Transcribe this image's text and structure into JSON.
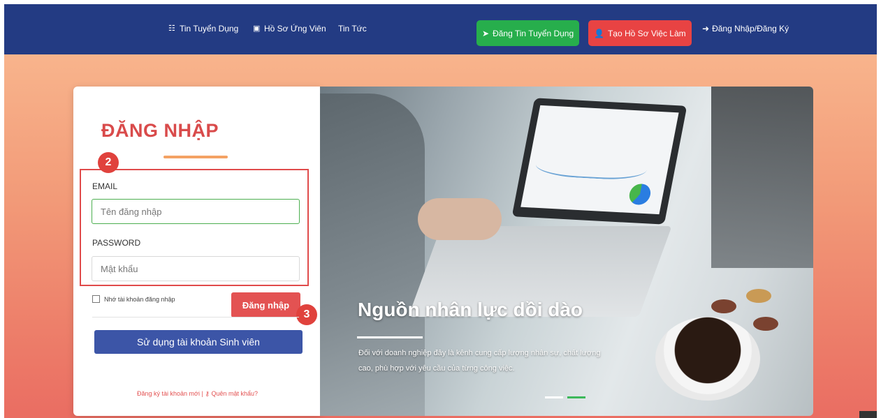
{
  "nav": {
    "jobs": "Tin Tuyển Dụng",
    "candidates": "Hồ Sơ Ứng Viên",
    "news": "Tin Tức",
    "post_job": "Đăng Tin Tuyển Dụng",
    "create_profile": "Tạo Hồ Sơ Việc Làm",
    "login_register": "Đăng Nhập/Đăng Ký"
  },
  "login": {
    "title": "ĐĂNG NHẬP",
    "email_label": "EMAIL",
    "email_placeholder": "Tên đăng nhập",
    "password_label": "PASSWORD",
    "password_placeholder": "Mật khẩu",
    "remember": "Nhớ tài khoản đăng nhập",
    "submit": "Đăng nhập",
    "student_button": "Sử dụng tài khoản Sinh viên",
    "register_link": "Đăng ký tài khoản mới",
    "separator": "|",
    "forgot_link": "Quên mật khẩu?"
  },
  "annotations": {
    "step2": "2",
    "step3": "3"
  },
  "hero": {
    "heading": "Nguồn nhân lực dồi dào",
    "text": "Đối với doanh nghiệp đây là kênh cung cấp lượng nhân sự, chất lượng cao, phù hợp với yêu cầu của từng công việc."
  },
  "colors": {
    "navbar": "#233b83",
    "green_button": "#27ae4c",
    "red_button": "#e84343",
    "title": "#d94b4b",
    "student_button": "#3c55a7"
  },
  "icons": {
    "jobs": "list-icon",
    "candidates": "id-card-icon",
    "post_job": "paper-plane-icon",
    "create_profile": "user-plus-icon",
    "login": "sign-in-icon",
    "forgot": "key-icon"
  }
}
